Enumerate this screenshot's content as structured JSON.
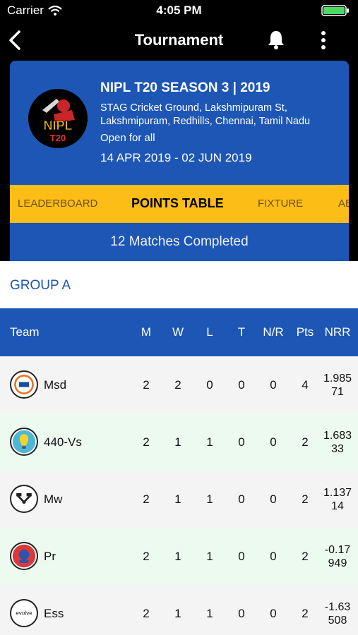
{
  "status_bar": {
    "carrier": "Carrier",
    "time": "4:05 PM"
  },
  "nav": {
    "title": "Tournament"
  },
  "tournament": {
    "name": "NIPL T20 SEASON 3 | 2019",
    "venue": "STAG Cricket Ground, Lakshmipuram St, Lakshmipuram, Redhills, Chennai, Tamil Nadu",
    "type": "Open for all",
    "dates": "14 APR 2019 - 02 JUN 2019",
    "logo_text_top": "NIPL",
    "logo_text_bottom": "T20"
  },
  "tabs": [
    {
      "label": "LEADERBOARD",
      "active": false
    },
    {
      "label": "POINTS TABLE",
      "active": true
    },
    {
      "label": "FIXTURE",
      "active": false
    },
    {
      "label": "AB",
      "active": false
    }
  ],
  "matches_completed": "12 Matches Completed",
  "group": {
    "title": "GROUP A"
  },
  "table": {
    "headers": {
      "team": "Team",
      "m": "M",
      "w": "W",
      "l": "L",
      "t": "T",
      "nr": "N/R",
      "pts": "Pts",
      "nrr": "NRR"
    },
    "rows": [
      {
        "team": "Msd",
        "m": "2",
        "w": "2",
        "l": "0",
        "t": "0",
        "nr": "0",
        "pts": "4",
        "nrr_1": "1.985",
        "nrr_2": "71"
      },
      {
        "team": "440-Vs",
        "m": "2",
        "w": "1",
        "l": "1",
        "t": "0",
        "nr": "0",
        "pts": "2",
        "nrr_1": "1.683",
        "nrr_2": "33"
      },
      {
        "team": "Mw",
        "m": "2",
        "w": "1",
        "l": "1",
        "t": "0",
        "nr": "0",
        "pts": "2",
        "nrr_1": "1.137",
        "nrr_2": "14"
      },
      {
        "team": "Pr",
        "m": "2",
        "w": "1",
        "l": "1",
        "t": "0",
        "nr": "0",
        "pts": "2",
        "nrr_1": "-0.17",
        "nrr_2": "949"
      },
      {
        "team": "Ess",
        "m": "2",
        "w": "1",
        "l": "1",
        "t": "0",
        "nr": "0",
        "pts": "2",
        "nrr_1": "-1.63",
        "nrr_2": "508",
        "logo_text": "evolve"
      }
    ]
  },
  "colors": {
    "primary_blue": "#1d56b5",
    "tab_yellow": "#fbbd16",
    "row_odd": "#f4f4f4",
    "row_even": "#edfaf0"
  },
  "icons": [
    "wifi-icon",
    "battery-icon",
    "back-arrow-icon",
    "bell-icon",
    "more-vertical-icon"
  ]
}
